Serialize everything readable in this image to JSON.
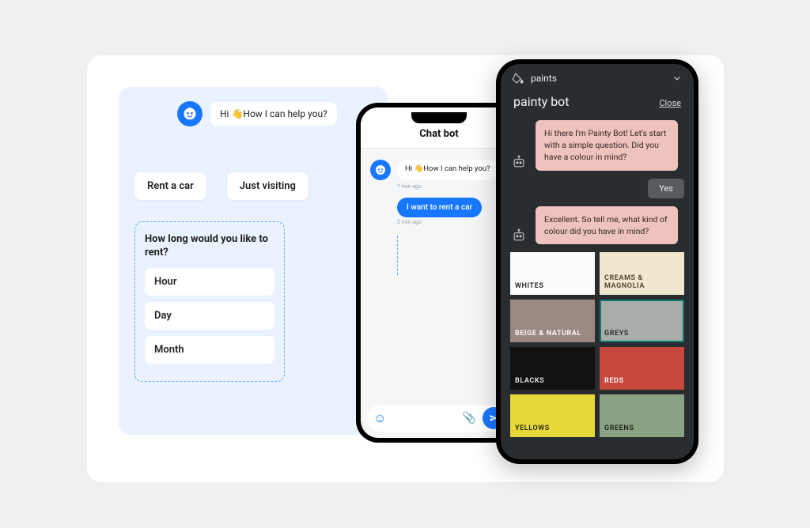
{
  "flow": {
    "greeting": "Hi 👋How I can help you?",
    "choices": {
      "rent": "Rent a car",
      "visit": "Just visiting"
    },
    "duration_title": "How long would you like to rent?",
    "options": {
      "hour": "Hour",
      "day": "Day",
      "month": "Month"
    }
  },
  "phone1": {
    "title": "Chat bot",
    "bot_msg": "Hi 👋How I can help you?",
    "bot_time": "1 min ago",
    "user_msg": "I want to rent a car",
    "user_time": "2 min ago"
  },
  "float": {
    "title": "How long would you like to rent?",
    "pills": {
      "hour": "hour",
      "day": "day",
      "month": "month"
    }
  },
  "phone2": {
    "breadcrumb": "paints",
    "title": "painty bot",
    "close": "Close",
    "msg1": "Hi there I'm Painty Bot! Let's start with a simple question. Did you have a colour in mind?",
    "yes": "Yes",
    "msg2": "Excellent. So tell me, what kind of colour did you have in mind?",
    "swatches": {
      "whites": "WHITES",
      "creams": "CREAMS & MAGNOLIA",
      "beige": "BEIGE & NATURAL",
      "greys": "GREYS",
      "blacks": "BLACKS",
      "reds": "REDS",
      "yellows": "YELLOWS",
      "greens": "GREENS"
    }
  }
}
